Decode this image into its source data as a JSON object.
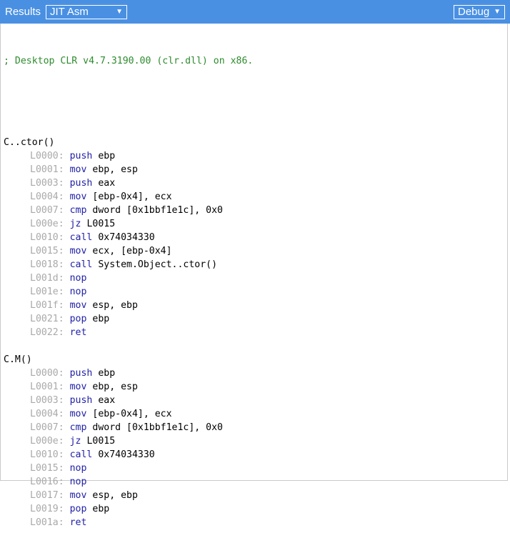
{
  "toolbar": {
    "title": "Results",
    "view_select": "JIT Asm",
    "mode_select": "Debug",
    "caret": "▼"
  },
  "comment": "; Desktop CLR v4.7.3190.00 (clr.dll) on x86.",
  "methods": [
    {
      "name": "C..ctor()",
      "lines": [
        {
          "label": "L0000:",
          "op": "push",
          "args": "ebp"
        },
        {
          "label": "L0001:",
          "op": "mov",
          "args": "ebp, esp"
        },
        {
          "label": "L0003:",
          "op": "push",
          "args": "eax"
        },
        {
          "label": "L0004:",
          "op": "mov",
          "args": "[ebp-0x4], ecx"
        },
        {
          "label": "L0007:",
          "op": "cmp",
          "args": "dword [0x1bbf1e1c], 0x0"
        },
        {
          "label": "L000e:",
          "op": "jz",
          "args": "L0015"
        },
        {
          "label": "L0010:",
          "op": "call",
          "args": "0x74034330"
        },
        {
          "label": "L0015:",
          "op": "mov",
          "args": "ecx, [ebp-0x4]"
        },
        {
          "label": "L0018:",
          "op": "call",
          "args": "System.Object..ctor()"
        },
        {
          "label": "L001d:",
          "op": "nop",
          "args": ""
        },
        {
          "label": "L001e:",
          "op": "nop",
          "args": ""
        },
        {
          "label": "L001f:",
          "op": "mov",
          "args": "esp, ebp"
        },
        {
          "label": "L0021:",
          "op": "pop",
          "args": "ebp"
        },
        {
          "label": "L0022:",
          "op": "ret",
          "args": ""
        }
      ]
    },
    {
      "name": "C.M()",
      "lines": [
        {
          "label": "L0000:",
          "op": "push",
          "args": "ebp"
        },
        {
          "label": "L0001:",
          "op": "mov",
          "args": "ebp, esp"
        },
        {
          "label": "L0003:",
          "op": "push",
          "args": "eax"
        },
        {
          "label": "L0004:",
          "op": "mov",
          "args": "[ebp-0x4], ecx"
        },
        {
          "label": "L0007:",
          "op": "cmp",
          "args": "dword [0x1bbf1e1c], 0x0"
        },
        {
          "label": "L000e:",
          "op": "jz",
          "args": "L0015"
        },
        {
          "label": "L0010:",
          "op": "call",
          "args": "0x74034330"
        },
        {
          "label": "L0015:",
          "op": "nop",
          "args": ""
        },
        {
          "label": "L0016:",
          "op": "nop",
          "args": ""
        },
        {
          "label": "L0017:",
          "op": "mov",
          "args": "esp, ebp"
        },
        {
          "label": "L0019:",
          "op": "pop",
          "args": "ebp"
        },
        {
          "label": "L001a:",
          "op": "ret",
          "args": ""
        }
      ]
    }
  ]
}
